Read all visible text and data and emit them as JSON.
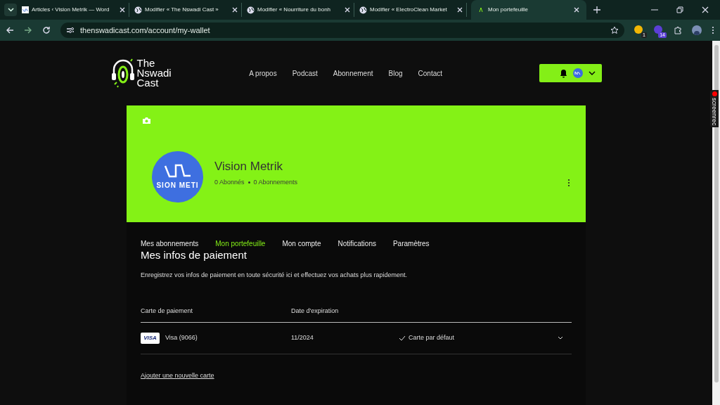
{
  "browser": {
    "tabs": [
      {
        "title": "Articles ‹ Vision Metrik — Word",
        "selected": false
      },
      {
        "title": "Modifier « The Nswadi Cast »",
        "selected": false
      },
      {
        "title": "Modifier « Nourriture du bonh",
        "selected": false
      },
      {
        "title": "Modifier « ElectroClean Market",
        "selected": false
      },
      {
        "title": "Mon portefeuille",
        "selected": true
      }
    ],
    "url": "thenswadicast.com/account/my-wallet",
    "extension_badges": [
      "1",
      "14"
    ]
  },
  "screenrec": "screenrec",
  "site": {
    "logo_lines": [
      "The",
      "Nswadi",
      "Cast"
    ],
    "nav": [
      "A propos",
      "Podcast",
      "Abonnement",
      "Blog",
      "Contact"
    ]
  },
  "profile": {
    "name": "Vision Metrik",
    "avatar_text": "SION METI",
    "followers": "0 Abonnés",
    "following": "0 Abonnements"
  },
  "account_tabs": [
    {
      "label": "Mes abonnements",
      "selected": false
    },
    {
      "label": "Mon portefeuille",
      "selected": true
    },
    {
      "label": "Mon compte",
      "selected": false
    },
    {
      "label": "Notifications",
      "selected": false
    },
    {
      "label": "Paramètres",
      "selected": false
    }
  ],
  "wallet": {
    "title": "Mes infos de paiement",
    "description": "Enregistrez vos infos de paiement en toute sécurité ici et effectuez vos achats plus rapidement.",
    "columns": [
      "Carte de paiement",
      "Date d'expiration"
    ],
    "cards": [
      {
        "brand": "VISA",
        "name": "Visa (9066)",
        "expiry": "11/2024",
        "default_label": "Carte par défaut",
        "is_default": true
      }
    ],
    "add_link": "Ajouter une nouvelle carte"
  }
}
